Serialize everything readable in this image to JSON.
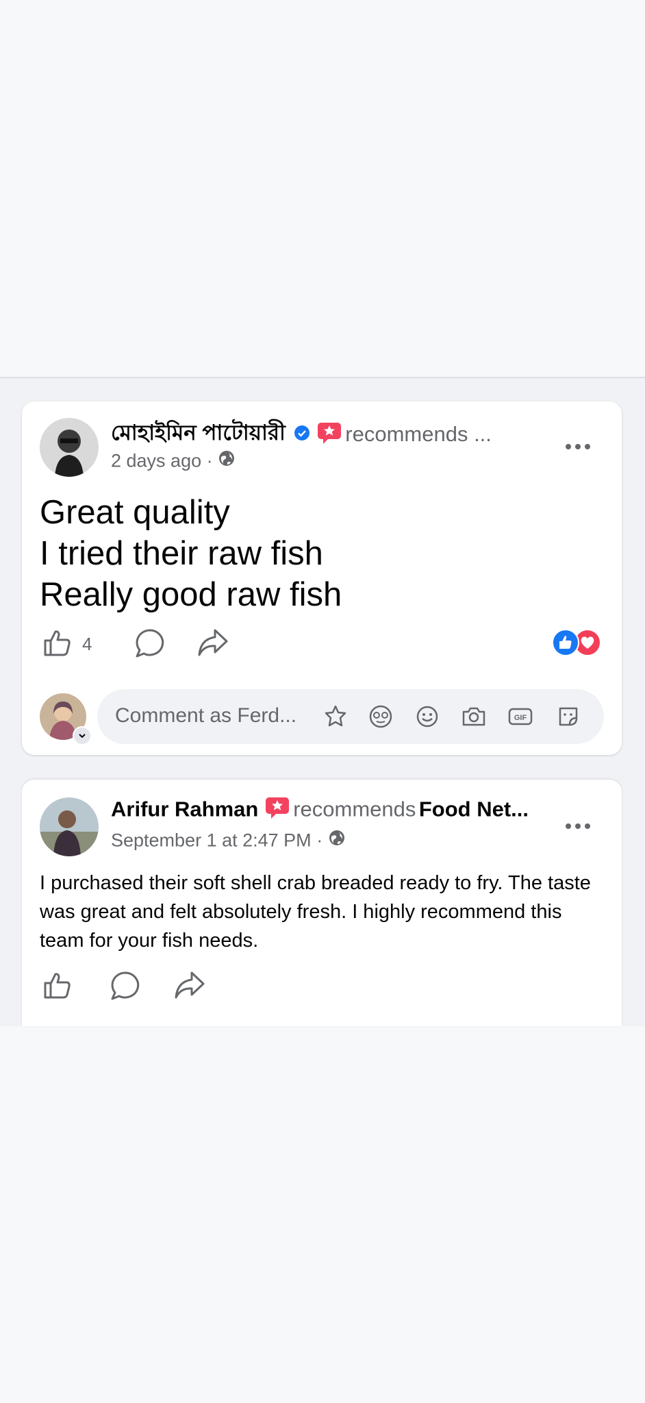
{
  "posts": [
    {
      "author": "মোহাইমিন পাটোয়ারী",
      "recommends": "recommends ...",
      "time": "2 days ago",
      "separator": "·",
      "text_lines": [
        "Great quality",
        "I tried their raw fish",
        "Really good raw fish"
      ],
      "like_count": "4",
      "comment_placeholder": "Comment as Ferd..."
    },
    {
      "author": "Arifur Rahman",
      "recommends": "recommends",
      "page": "Food Net...",
      "time": "September 1 at 2:47 PM",
      "separator": "·",
      "text": "I purchased their soft shell crab breaded ready to fry. The taste was great and felt absolutely fresh. I highly recommend this team for your fish needs."
    }
  ],
  "colors": {
    "recommend_badge": "#f3425f",
    "verified": "#1877f2",
    "like_reaction": "#1877f2",
    "love_reaction": "#f33e58",
    "secondary_text": "#65676b"
  },
  "icons": [
    "verified-badge-icon",
    "recommend-badge-icon",
    "globe-icon",
    "more-options-icon",
    "like-icon",
    "comment-icon",
    "share-icon",
    "like-reaction-icon",
    "love-reaction-icon",
    "avatar-sticker-icon",
    "emoji-face-icon",
    "smile-icon",
    "camera-icon",
    "gif-icon",
    "sticker-icon",
    "chevron-down-icon"
  ]
}
